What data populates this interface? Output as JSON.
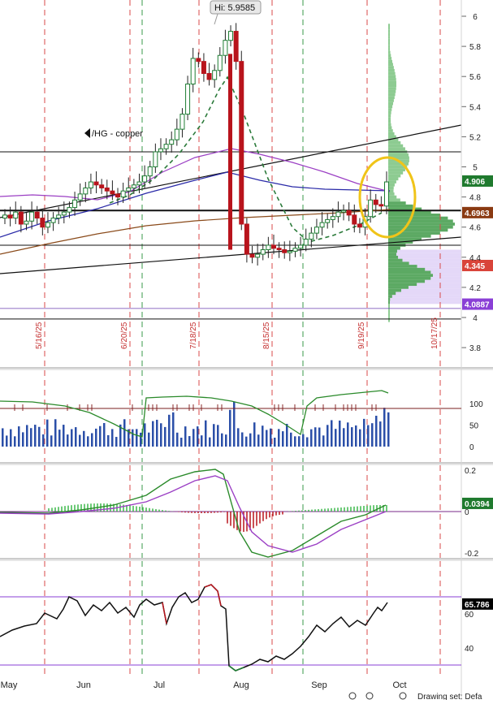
{
  "chart_data": [
    {
      "type": "candlestick",
      "symbol_label": "/HG - copper",
      "high_marker": "Hi: 5.9585",
      "y_ticks": [
        "6",
        "5.8",
        "5.6",
        "5.4",
        "5.2",
        "5",
        "4.8",
        "4.6",
        "4.4",
        "4.2",
        "4",
        "3.8"
      ],
      "y_tick_values": [
        6.0,
        5.8,
        5.6,
        5.4,
        5.2,
        5.0,
        4.8,
        4.6,
        4.4,
        4.2,
        4.0,
        3.8
      ],
      "ylim": [
        3.65,
        6.1
      ],
      "x_labels": [
        "May",
        "Jun",
        "Jul",
        "Aug",
        "Sep",
        "Oct"
      ],
      "event_dates": [
        "5/16/25",
        "6/20/25",
        "7/18/25",
        "8/15/25",
        "9/19/25",
        "10/17/25"
      ],
      "price_badges": [
        {
          "text": "4.906",
          "value": 4.906,
          "color": "#1f7a2e"
        },
        {
          "text": "4.6963",
          "value": 4.6963,
          "color": "#8a3a12"
        },
        {
          "text": "4.345",
          "value": 4.345,
          "color": "#d9443a"
        },
        {
          "text": "4.0887",
          "value": 4.0887,
          "color": "#8a3fd6"
        }
      ],
      "horizontal_levels": [
        5.1,
        4.71,
        4.48,
        3.99
      ],
      "closes": [
        4.68,
        4.66,
        4.7,
        4.62,
        4.64,
        4.7,
        4.66,
        4.6,
        4.63,
        4.66,
        4.68,
        4.7,
        4.73,
        4.78,
        4.82,
        4.86,
        4.9,
        4.88,
        4.86,
        4.84,
        4.82,
        4.8,
        4.84,
        4.86,
        4.88,
        4.9,
        4.94,
        5.0,
        5.1,
        5.12,
        5.15,
        5.18,
        5.25,
        5.35,
        5.55,
        5.72,
        5.7,
        5.62,
        5.58,
        5.64,
        5.74,
        5.84,
        5.9,
        5.7,
        4.62,
        4.42,
        4.4,
        4.42,
        4.45,
        4.48,
        4.46,
        4.45,
        4.43,
        4.44,
        4.46,
        4.48,
        4.52,
        4.56,
        4.6,
        4.63,
        4.65,
        4.67,
        4.7,
        4.71,
        4.68,
        4.62,
        4.6,
        4.67,
        4.78,
        4.75,
        4.74,
        4.9
      ],
      "candle_colors": {
        "up": "#1e7d33",
        "down": "#b8141c"
      }
    },
    {
      "type": "bar+line",
      "y_ticks": [
        "100",
        "50",
        "0"
      ],
      "y_tick_values": [
        100,
        50,
        0
      ],
      "ylim": [
        0,
        130
      ]
    },
    {
      "type": "macd",
      "y_ticks": [
        "0.2",
        "0",
        "-0.2"
      ],
      "y_tick_values": [
        0.2,
        0,
        -0.2
      ],
      "ylim": [
        -0.25,
        0.25
      ],
      "badge": {
        "text": "0.0394",
        "value": 0.0394,
        "color": "#1f7a2e"
      }
    },
    {
      "type": "line",
      "y_ticks": [
        "60",
        "40"
      ],
      "y_tick_values": [
        60,
        40
      ],
      "ylim": [
        25,
        75
      ],
      "levels": [
        70,
        30
      ],
      "badge": {
        "text": "65.786",
        "value": 65.786,
        "color": "#000000"
      }
    }
  ],
  "footer": {
    "status_text": "Drawing set: Defa"
  }
}
